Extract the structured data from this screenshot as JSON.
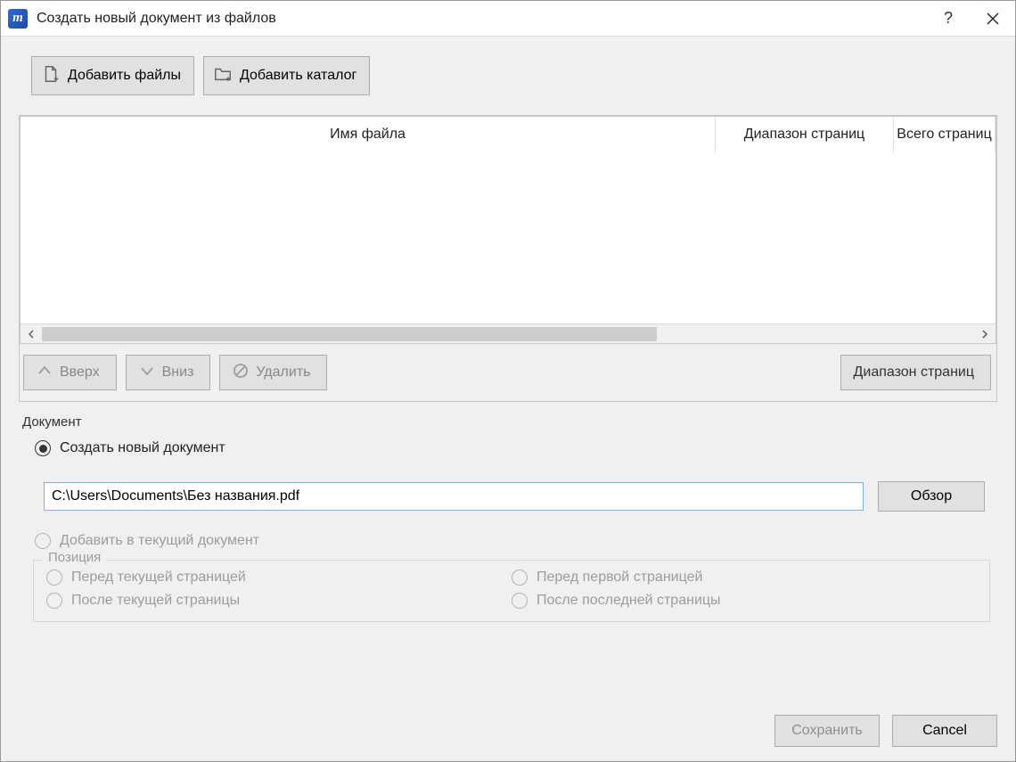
{
  "window": {
    "title": "Создать новый документ из файлов"
  },
  "toolbar": {
    "add_files": "Добавить файлы",
    "add_folder": "Добавить каталог"
  },
  "file_list": {
    "columns": {
      "filename": "Имя файла",
      "page_range": "Диапазон страниц",
      "total_pages": "Всего страниц"
    },
    "rows": []
  },
  "list_actions": {
    "up": "Вверх",
    "down": "Вниз",
    "delete": "Удалить",
    "page_range": "Диапазон страниц"
  },
  "document": {
    "group_label": "Документ",
    "create_new": "Создать новый документ",
    "add_to_current": "Добавить в текущий документ",
    "path_value": "C:\\Users\\Documents\\Без названия.pdf",
    "browse": "Обзор"
  },
  "position": {
    "legend": "Позиция",
    "before_current": "Перед текущей страницей",
    "after_current": "После текущей страницы",
    "before_first": "Перед первой страницей",
    "after_last": "После последней страницы"
  },
  "footer": {
    "save": "Сохранить",
    "cancel": "Cancel"
  }
}
